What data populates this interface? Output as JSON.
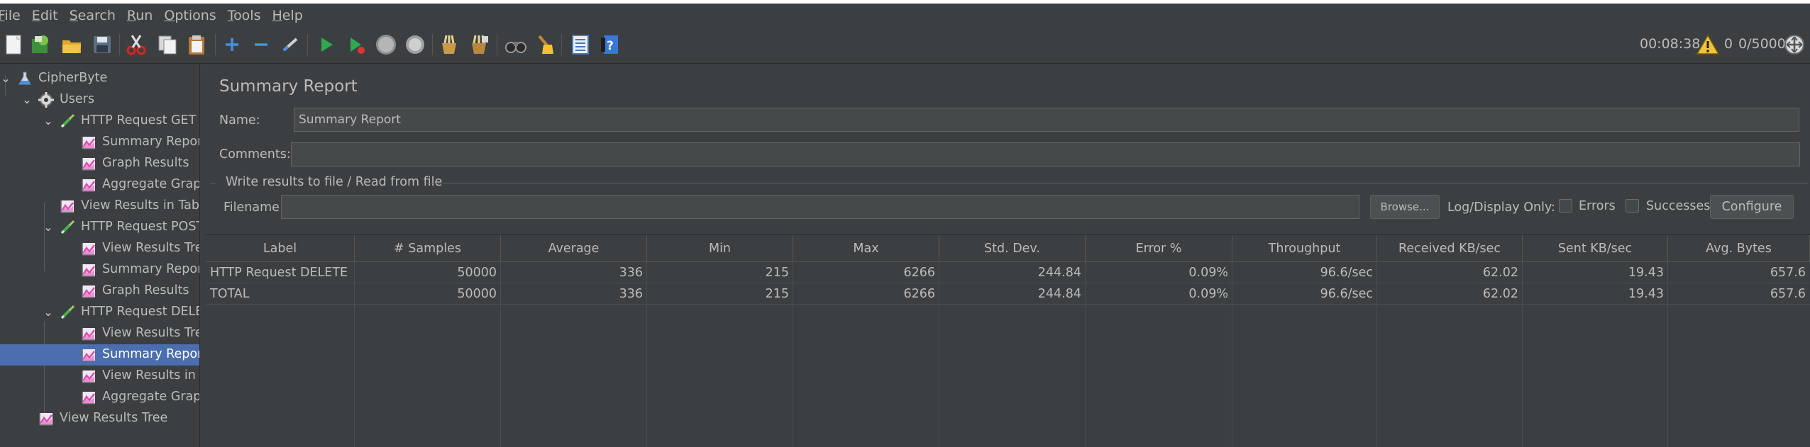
{
  "menubar": {
    "items": [
      {
        "mn": "F",
        "rest": "ile"
      },
      {
        "mn": "E",
        "rest": "dit"
      },
      {
        "mn": "S",
        "rest": "earch"
      },
      {
        "mn": "R",
        "rest": "un"
      },
      {
        "mn": "O",
        "rest": "ptions"
      },
      {
        "mn": "T",
        "rest": "ools"
      },
      {
        "mn": "H",
        "rest": "elp"
      }
    ]
  },
  "toolbar": {
    "elapsed_time": "00:08:38",
    "warning_count": "0",
    "thread_count": "0/5000"
  },
  "tree": {
    "items": [
      {
        "label": "CipherByte",
        "icon": "test-plan-icon"
      },
      {
        "label": "Users",
        "icon": "thread-group-gear-icon"
      },
      {
        "label": "HTTP Request GET",
        "icon": "sampler-pipette-icon"
      },
      {
        "label": "Summary Report",
        "icon": "listener-chart-icon"
      },
      {
        "label": "Graph Results",
        "icon": "listener-chart-icon"
      },
      {
        "label": "Aggregate Graph",
        "icon": "listener-chart-icon"
      },
      {
        "label": "View Results in Table",
        "icon": "listener-chart-icon"
      },
      {
        "label": "HTTP Request POST",
        "icon": "sampler-pipette-icon"
      },
      {
        "label": "View Results Tree",
        "icon": "listener-chart-icon"
      },
      {
        "label": "Summary Report",
        "icon": "listener-chart-icon"
      },
      {
        "label": "Graph Results",
        "icon": "listener-chart-icon"
      },
      {
        "label": "HTTP Request DELETE",
        "icon": "sampler-pipette-icon"
      },
      {
        "label": "View Results Tree",
        "icon": "listener-chart-icon"
      },
      {
        "label": "Summary Report",
        "icon": "listener-chart-icon"
      },
      {
        "label": "View Results in Table",
        "icon": "listener-chart-icon"
      },
      {
        "label": "Aggregate Graph",
        "icon": "listener-chart-icon"
      },
      {
        "label": "View Results Tree",
        "icon": "listener-chart-icon"
      }
    ]
  },
  "panel": {
    "title": "Summary Report",
    "name_label": "Name:",
    "name_value": "Summary Report",
    "comments_label": "Comments:",
    "comments_value": "",
    "file_group_title": "Write results to file / Read from file",
    "filename_label": "Filename",
    "filename_value": "",
    "browse_label": "Browse...",
    "log_display_label": "Log/Display Only:",
    "errors_label": "Errors",
    "successes_label": "Successes",
    "configure_label": "Configure"
  },
  "table": {
    "columns": [
      "Label",
      "# Samples",
      "Average",
      "Min",
      "Max",
      "Std. Dev.",
      "Error %",
      "Throughput",
      "Received KB/sec",
      "Sent KB/sec",
      "Avg. Bytes"
    ],
    "rows": [
      [
        "HTTP Request DELETE",
        "50000",
        "336",
        "215",
        "6266",
        "244.84",
        "0.09%",
        "96.6/sec",
        "62.02",
        "19.43",
        "657.6"
      ],
      [
        "TOTAL",
        "50000",
        "336",
        "215",
        "6266",
        "244.84",
        "0.09%",
        "96.6/sec",
        "62.02",
        "19.43",
        "657.6"
      ]
    ]
  },
  "colors": {
    "background": "#3c3f41",
    "selection": "#4b6eaf",
    "text": "#bbbbbb"
  }
}
